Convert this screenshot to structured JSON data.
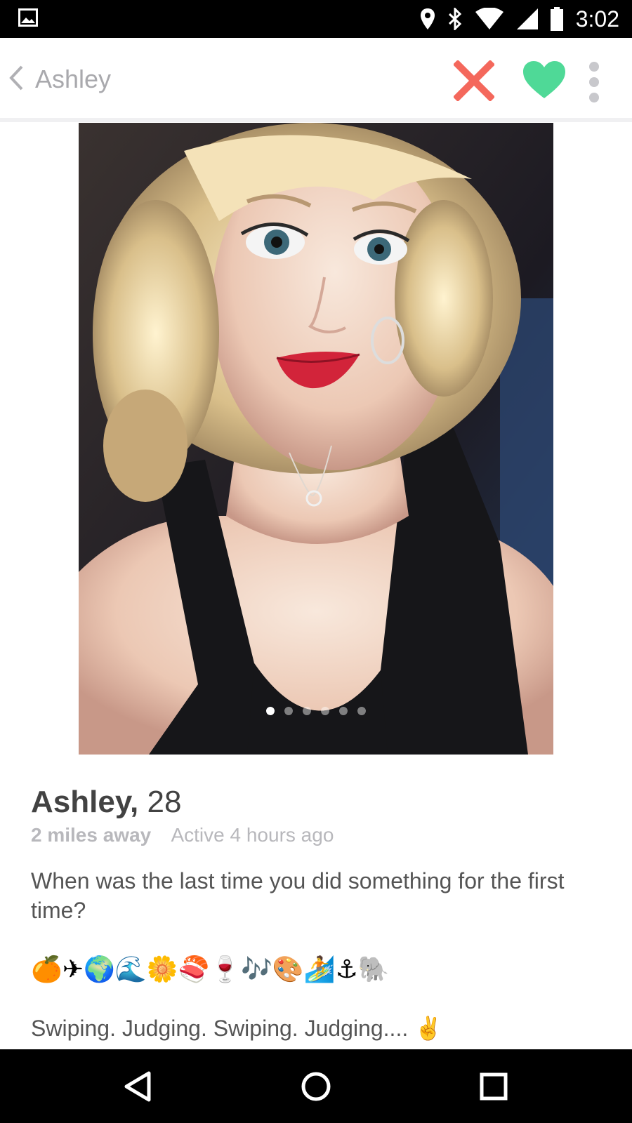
{
  "status_bar": {
    "time": "3:02",
    "icons": [
      "gallery-icon",
      "location-icon",
      "bluetooth-icon",
      "wifi-icon",
      "signal-icon",
      "battery-icon"
    ]
  },
  "header": {
    "back_icon": "chevron-left-icon",
    "title": "Ashley",
    "actions": [
      "close-icon",
      "heart-icon",
      "more-vertical-icon"
    ]
  },
  "photo": {
    "page_count": 6,
    "active_page": 1
  },
  "profile": {
    "name": "Ashley,",
    "age": "28",
    "distance": "2 miles away",
    "active": "Active 4 hours ago",
    "bio": "When was the last time you did something for the first time?",
    "emojis": "🍊✈🌍🌊🌼🍣🍷🎶🎨🏄⚓🐘",
    "tagline": "Swiping. Judging. Swiping. Judging....  ✌"
  },
  "colors": {
    "reject": "#f4685c",
    "like": "#4fd997",
    "muted_text": "#b8b8bc"
  },
  "nav_bar": {
    "buttons": [
      "back-triangle-icon",
      "home-circle-icon",
      "recents-square-icon"
    ]
  }
}
